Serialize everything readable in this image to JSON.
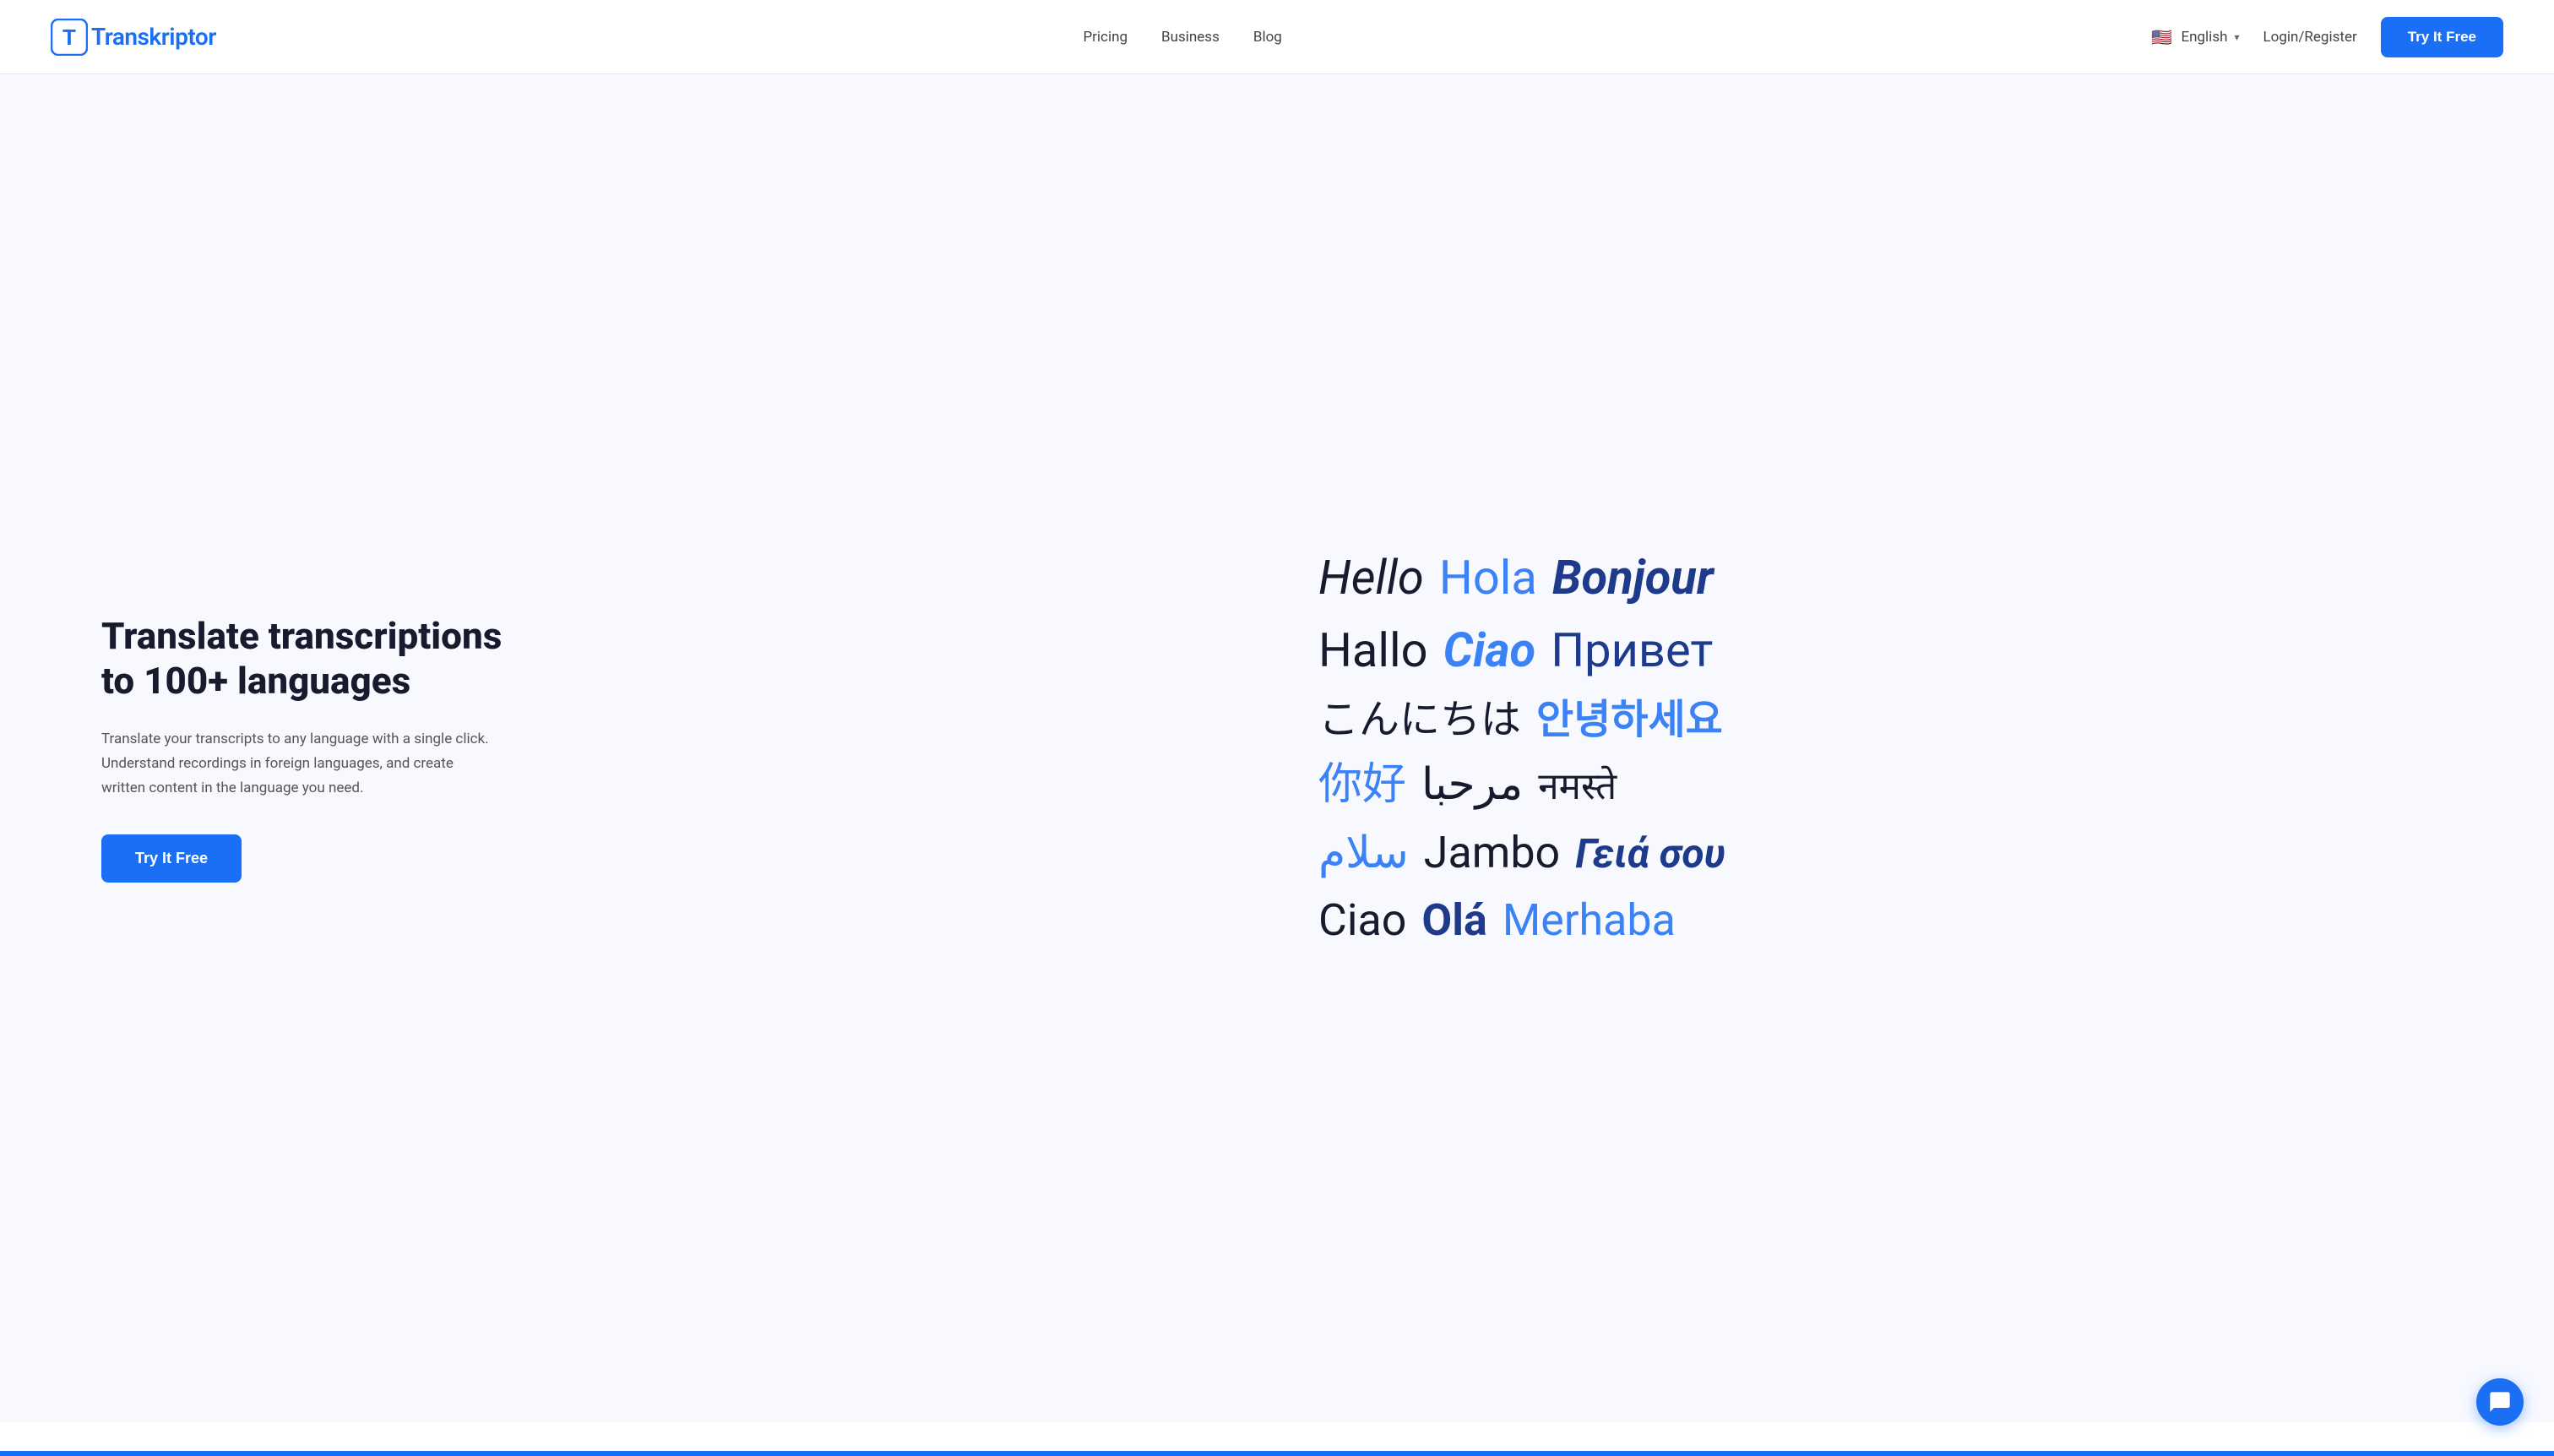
{
  "brand": {
    "name": "Transkriptor",
    "logo_letter": "T"
  },
  "navbar": {
    "links": [
      {
        "id": "pricing",
        "label": "Pricing"
      },
      {
        "id": "business",
        "label": "Business"
      },
      {
        "id": "blog",
        "label": "Blog"
      }
    ],
    "language": {
      "flag": "🇺🇸",
      "label": "English"
    },
    "login_label": "Login/Register",
    "try_free_label": "Try It Free"
  },
  "hero": {
    "title": "Translate transcriptions to 100+ languages",
    "description": "Translate your transcripts to any language with a single click. Understand recordings in foreign languages, and create written content in the language you need.",
    "try_free_label": "Try It Free"
  },
  "language_cloud": {
    "rows": [
      [
        {
          "text": "Hello",
          "color": "dark",
          "weight": "italic",
          "size": "56"
        },
        {
          "text": "Hola",
          "color": "blue",
          "weight": "normal",
          "size": "56"
        },
        {
          "text": "Bonjour",
          "color": "dblue",
          "weight": "bolditalic",
          "size": "56"
        }
      ],
      [
        {
          "text": "Hallo",
          "color": "dark",
          "weight": "normal",
          "size": "56"
        },
        {
          "text": "Ciao",
          "color": "blue",
          "weight": "bolditalic",
          "size": "56"
        },
        {
          "text": "Привет",
          "color": "dblue",
          "weight": "normal",
          "size": "56"
        }
      ],
      [
        {
          "text": "こんにちは",
          "color": "dark",
          "weight": "normal",
          "size": "48"
        },
        {
          "text": "안녕하세요",
          "color": "blue",
          "weight": "bold",
          "size": "48"
        }
      ],
      [
        {
          "text": "你好",
          "color": "blue",
          "weight": "normal",
          "size": "52"
        },
        {
          "text": "مرحبا",
          "color": "dark",
          "weight": "normal",
          "size": "52"
        },
        {
          "text": "नमस्ते",
          "color": "dark",
          "weight": "normal",
          "size": "44"
        }
      ],
      [
        {
          "text": "سلام",
          "color": "blue",
          "weight": "normal",
          "size": "52"
        },
        {
          "text": "Jambo",
          "color": "dark",
          "weight": "normal",
          "size": "52"
        },
        {
          "text": "Γειά σου",
          "color": "dblue",
          "weight": "bolditalic",
          "size": "48"
        }
      ],
      [
        {
          "text": "Ciao",
          "color": "dark",
          "weight": "normal",
          "size": "52"
        },
        {
          "text": "Olá",
          "color": "dblue",
          "weight": "bold",
          "size": "52"
        },
        {
          "text": "Merhaba",
          "color": "blue",
          "weight": "normal",
          "size": "52"
        }
      ]
    ]
  }
}
